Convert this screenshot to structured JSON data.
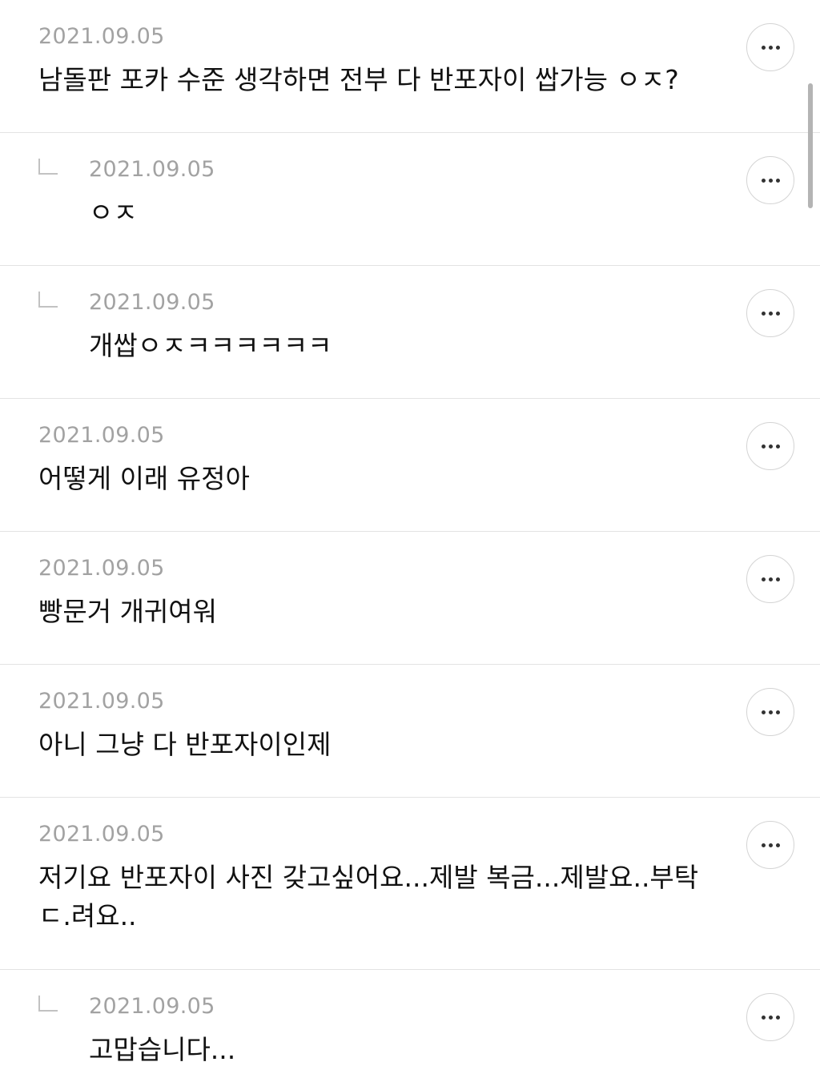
{
  "comments": [
    {
      "date": "2021.09.05",
      "text": "남돌판 포카 수준 생각하면 전부 다 반포자이 쌉가능 ㅇㅈ?",
      "reply": false
    },
    {
      "date": "2021.09.05",
      "text": "ㅇㅈ",
      "reply": true
    },
    {
      "date": "2021.09.05",
      "text": "개쌉ㅇㅈㅋㅋㅋㅋㅋㅋ",
      "reply": true
    },
    {
      "date": "2021.09.05",
      "text": "어떻게 이래 유정아",
      "reply": false
    },
    {
      "date": "2021.09.05",
      "text": "빵문거 개귀여워",
      "reply": false
    },
    {
      "date": "2021.09.05",
      "text": "아니 그냥 다 반포자이인제",
      "reply": false
    },
    {
      "date": "2021.09.05",
      "text": "저기요 반포자이 사진 갖고싶어요...제발 복금...제발요..부탁ㄷ.려요..",
      "reply": false
    },
    {
      "date": "2021.09.05",
      "text": "고맙습니다...",
      "reply": true
    }
  ],
  "icons": {
    "reply": "reply-corner-icon",
    "more": "more-dots-icon"
  }
}
